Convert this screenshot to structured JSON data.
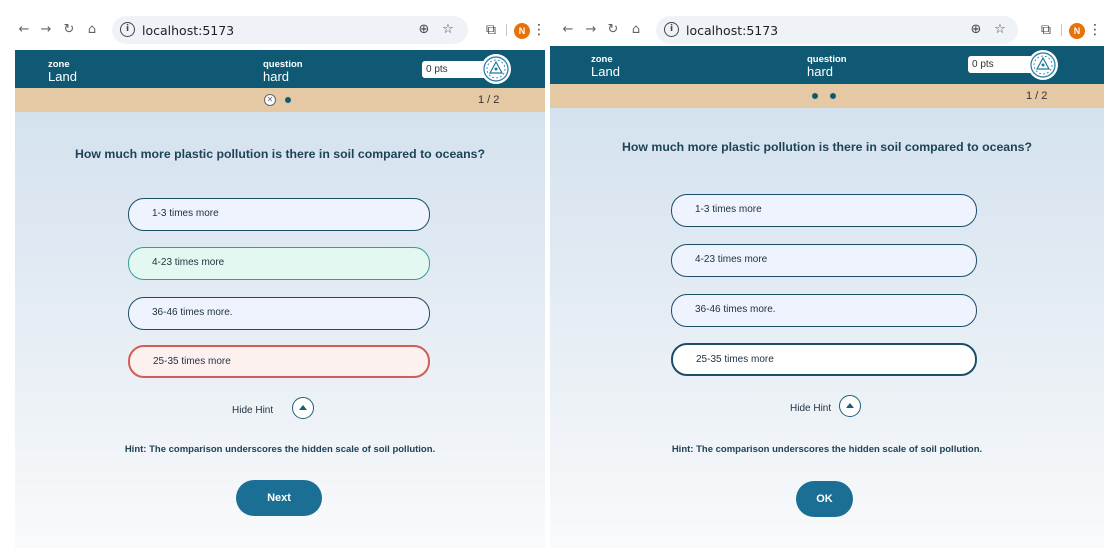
{
  "browser": {
    "url": "localhost:5173",
    "avatar_initial": "N",
    "nav_icons": [
      "back-arrow-icon",
      "forward-arrow-icon",
      "reload-icon",
      "home-icon"
    ]
  },
  "header": {
    "zone_label": "zone",
    "zone_value": "Land",
    "question_label": "question",
    "question_value": "hard",
    "points": "0 pts"
  },
  "progress": {
    "counter": "1 / 2"
  },
  "quiz": {
    "question": "How much more plastic pollution is there in soil compared to oceans?",
    "answers": [
      "1-3 times more",
      "4-23 times more",
      "36-46 times more.",
      "25-35 times more"
    ],
    "hide_hint_label": "Hide Hint",
    "hint": "Hint: The comparison underscores the hidden scale of soil pollution."
  },
  "left_screen": {
    "state": "answered",
    "correct_answer_index": 1,
    "wrong_answer_index": 3,
    "action_button": "Next"
  },
  "right_screen": {
    "state": "selecting",
    "selected_answer_index": 3,
    "action_button": "OK"
  },
  "colors": {
    "header": "#0f5974",
    "progress_bar": "#e5c9a5",
    "button": "#1c6f94",
    "correct": "#3a9b93",
    "wrong": "#d25d55"
  }
}
